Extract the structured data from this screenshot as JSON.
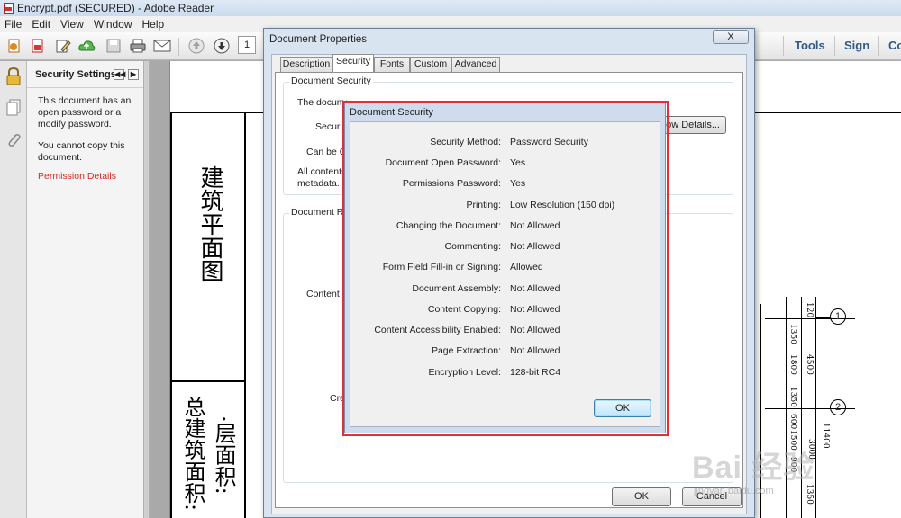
{
  "window": {
    "title": "Encrypt.pdf (SECURED) - Adobe Reader"
  },
  "menu": [
    "File",
    "Edit",
    "View",
    "Window",
    "Help"
  ],
  "toolbar": {
    "page_number": "1",
    "tools_label": "Tools",
    "sign_label": "Sign",
    "comment_label": "Co"
  },
  "security_panel": {
    "title": "Security Settings",
    "message1": "This document has an open password or a modify password.",
    "message2": "You cannot copy this document.",
    "permission_link": "Permission Details"
  },
  "document": {
    "title_vertical": "建筑平面图",
    "text_vertical1": "总建筑面积:",
    "text_vertical2": "·层面积:",
    "dims": [
      "120",
      "1350",
      "1800",
      "4500",
      "1350",
      "600",
      "1500",
      "11400",
      "3000",
      "900",
      "1350"
    ],
    "markers": [
      "1",
      "2"
    ]
  },
  "doc_properties": {
    "title": "Document Properties",
    "close_label": "X",
    "tabs": [
      "Description",
      "Security",
      "Fonts",
      "Custom",
      "Advanced"
    ],
    "active_tab": "Security",
    "group_security_title": "Document Security",
    "text_method_line": "The document's Security Method restricts what can be done to the document.",
    "label_security": "Securit",
    "show_details_label": "ow Details...",
    "label_can_be_opened": "Can be O",
    "text_all_contents": "All contents",
    "text_metadata": "metadata.",
    "group_restrictions_title": "Document R",
    "label_content": "Content C",
    "label_creation": "Cre",
    "ok_label": "OK",
    "cancel_label": "Cancel"
  },
  "doc_security": {
    "title": "Document Security",
    "rows": [
      {
        "label": "Security Method:",
        "value": "Password Security"
      },
      {
        "label": "Document Open Password:",
        "value": "Yes"
      },
      {
        "label": "Permissions Password:",
        "value": "Yes"
      },
      {
        "label": "Printing:",
        "value": "Low Resolution (150 dpi)"
      },
      {
        "label": "Changing the Document:",
        "value": "Not Allowed"
      },
      {
        "label": "Commenting:",
        "value": "Not Allowed"
      },
      {
        "label": "Form Field Fill-in or Signing:",
        "value": "Allowed"
      },
      {
        "label": "Document Assembly:",
        "value": "Not Allowed"
      },
      {
        "label": "Content Copying:",
        "value": "Not Allowed"
      },
      {
        "label": "Content Accessibility Enabled:",
        "value": "Not Allowed"
      },
      {
        "label": "Page Extraction:",
        "value": "Not Allowed"
      },
      {
        "label": "Encryption Level:",
        "value": "128-bit RC4"
      }
    ],
    "ok_label": "OK"
  },
  "watermark": {
    "text": "Bai 经验",
    "sub": "jingyan.baidu.com"
  },
  "colors": {
    "highlight": "#e0303a",
    "link": "#d52b1e",
    "accent": "#2f5a8a"
  }
}
